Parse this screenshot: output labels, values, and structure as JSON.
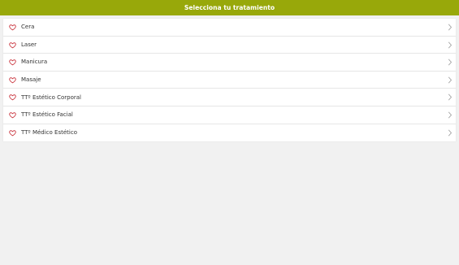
{
  "header": {
    "title": "Selecciona tu tratamiento"
  },
  "colors": {
    "header_bg": "#98a80a",
    "heart": "#c4222c",
    "chevron": "#9e9e9e"
  },
  "icons": {
    "item": "heart-outline-icon",
    "arrow": "chevron-right-icon"
  },
  "items": [
    {
      "label": "Cera"
    },
    {
      "label": "Laser"
    },
    {
      "label": "Manicura"
    },
    {
      "label": "Masaje"
    },
    {
      "label": "TTº Estético Corporal"
    },
    {
      "label": "TTº Estético Facial"
    },
    {
      "label": "TTº Médico Estético"
    }
  ]
}
